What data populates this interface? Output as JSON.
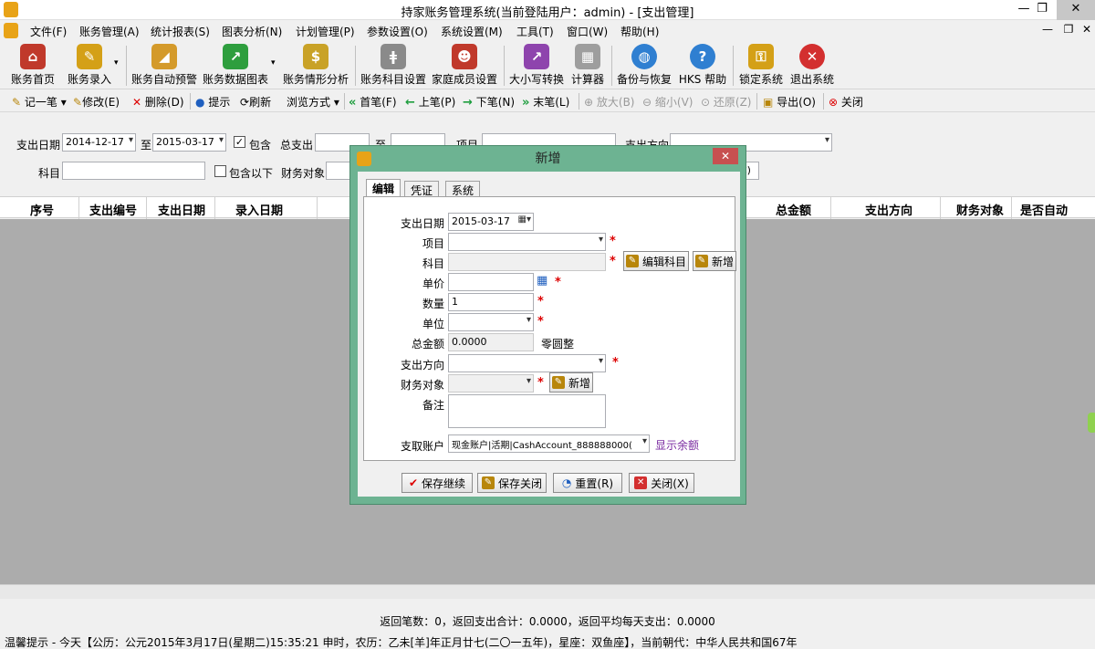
{
  "window": {
    "title": "持家账务管理系统(当前登陆用户：admin) - [支出管理]",
    "controls": [
      "—",
      "❐",
      "✕"
    ]
  },
  "menu": {
    "items": [
      "文件(F)",
      "账务管理(A)",
      "统计报表(S)",
      "图表分析(N)",
      "计划管理(P)",
      "参数设置(O)",
      "系统设置(M)",
      "工具(T)",
      "窗口(W)",
      "帮助(H)"
    ],
    "mdi_controls": [
      "—",
      "❐",
      "✕"
    ]
  },
  "toolbar": {
    "items": [
      {
        "label": "账务首页",
        "icon": "house-icon",
        "color": "#c0392b"
      },
      {
        "label": "账务录入",
        "icon": "notepad-pencil-icon",
        "color": "#d4a017"
      },
      {
        "label": "账务自动预警",
        "icon": "horn-icon",
        "color": "#d49a2a"
      },
      {
        "label": "账务数据图表",
        "icon": "chart-icon",
        "color": "#2e9e3e"
      },
      {
        "label": "账务情形分析",
        "icon": "money-bag-icon",
        "color": "#c9a227"
      },
      {
        "label": "账务科目设置",
        "icon": "fork-knife-icon",
        "color": "#8a8a8a"
      },
      {
        "label": "家庭成员设置",
        "icon": "people-icon",
        "color": "#c0392b"
      },
      {
        "label": "大小写转换",
        "icon": "convert-arrow-icon",
        "color": "#8e44ad"
      },
      {
        "label": "计算器",
        "icon": "calculator-icon",
        "color": "#9e9e9e"
      },
      {
        "label": "备份与恢复",
        "icon": "globe-icon",
        "color": "#2f7fd1"
      },
      {
        "label": "HKS 帮助",
        "icon": "help-icon",
        "color": "#2f7fd1"
      },
      {
        "label": "锁定系统",
        "icon": "lock-icon",
        "color": "#d4a017"
      },
      {
        "label": "退出系统",
        "icon": "exit-icon",
        "color": "#d32f2f"
      }
    ]
  },
  "toolbar2": {
    "add": "记一笔",
    "edit": "修改(E)",
    "delete": "删除(D)",
    "hint": "提示",
    "refresh": "刷新",
    "browse": "浏览方式",
    "first": "首笔(F)",
    "prev": "上笔(P)",
    "next": "下笔(N)",
    "last": "末笔(L)",
    "zoom_in": "放大(B)",
    "zoom_out": "缩小(V)",
    "restore": "还原(Z)",
    "export": "导出(O)",
    "close": "关闭"
  },
  "filter": {
    "date_label": "支出日期",
    "date_from": "2014-12-17",
    "to_label": "至",
    "date_to": "2015-03-17",
    "include_label": "包含",
    "include_checked": true,
    "total_label": "总支出",
    "total_to_label": "至",
    "item_label": "项目",
    "direction_label": "支出方向",
    "subject_label": "科目",
    "include_below_label": "包含以下",
    "include_below_checked": false,
    "target_label": "财务对象",
    "c_fragment": "C)"
  },
  "grid": {
    "columns": [
      "序号",
      "支出编号",
      "支出日期",
      "录入日期",
      "总金额",
      "支出方向",
      "财务对象",
      "是否自动"
    ]
  },
  "summary": "返回笔数：0，返回支出合计：0.0000，返回平均每天支出：0.0000",
  "status": "温馨提示 - 今天【公历：公元2015年3月17日(星期二)15:35:21 申时，农历：乙未[羊]年正月廿七(二〇一五年)，星座：双鱼座】，当前朝代：中华人民共和国67年",
  "dialog": {
    "title": "新增",
    "tabs": [
      "编辑",
      "凭证",
      "系统"
    ],
    "fields": {
      "date_label": "支出日期",
      "date_value": "2015-03-17",
      "item_label": "项目",
      "subject_label": "科目",
      "edit_subject_btn": "编辑科目",
      "new_btn": "新增",
      "price_label": "单价",
      "qty_label": "数量",
      "qty_value": "1",
      "unit_label": "单位",
      "amount_label": "总金额",
      "amount_value": "0.0000",
      "amount_words": "零圆整",
      "direction_label": "支出方向",
      "target_label": "财务对象",
      "target_new_btn": "新增",
      "note_label": "备注",
      "account_label": "支取账户",
      "account_value": "现金账户|活期|CashAccount_888888000(",
      "show_balance": "显示余额"
    },
    "buttons": {
      "save_continue": "保存继续",
      "save_close": "保存关闭",
      "reset": "重置(R)",
      "close": "关闭(X)"
    }
  }
}
